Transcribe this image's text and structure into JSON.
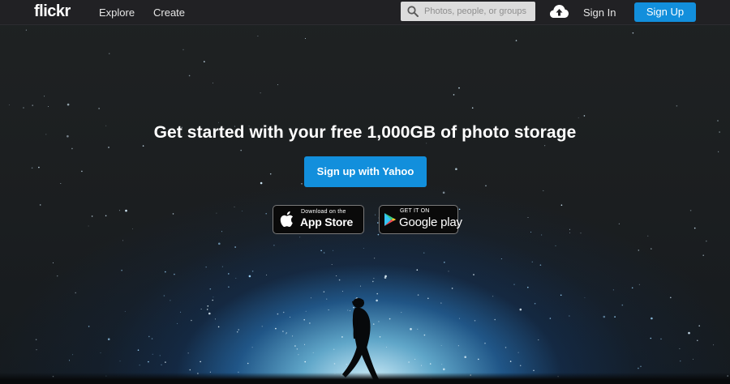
{
  "topbar": {
    "logo": "flickr",
    "nav": [
      {
        "label": "Explore"
      },
      {
        "label": "Create"
      }
    ],
    "search": {
      "placeholder": "Photos, people, or groups",
      "icon": "search-icon"
    },
    "upload_icon": "cloud-upload-icon",
    "signin_label": "Sign In",
    "signup_label": "Sign Up"
  },
  "hero": {
    "headline": "Get started with your free 1,000GB of photo storage",
    "cta_label": "Sign up with Yahoo",
    "badges": {
      "appstore": {
        "small": "Download on the",
        "big": "App Store",
        "icon": "apple-icon"
      },
      "googleplay": {
        "small": "GET IT ON",
        "big": "Google play",
        "icon": "google-play-icon"
      }
    }
  },
  "colors": {
    "topbar_bg": "#212124",
    "accent_blue": "#128fdc",
    "page_bg": "#1a1d1e"
  }
}
